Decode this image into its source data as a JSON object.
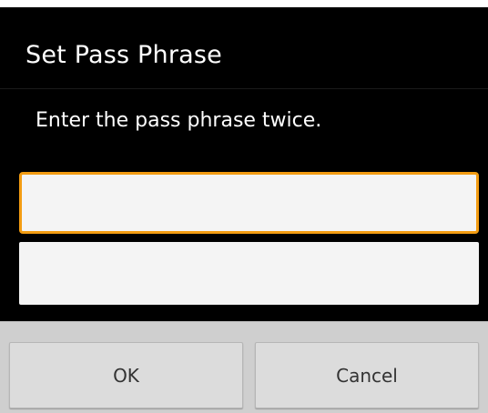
{
  "dialog": {
    "title": "Set Pass Phrase",
    "message": "Enter the pass phrase twice.",
    "fields": [
      {
        "value": "",
        "placeholder": ""
      },
      {
        "value": "",
        "placeholder": ""
      }
    ],
    "buttons": {
      "ok_label": "OK",
      "cancel_label": "Cancel"
    }
  },
  "colors": {
    "background": "#000000",
    "focus_border": "#f39c12",
    "field_fill": "#f4f4f4",
    "button_bar": "#cfcfcf",
    "button_fill": "#dcdcdc"
  }
}
